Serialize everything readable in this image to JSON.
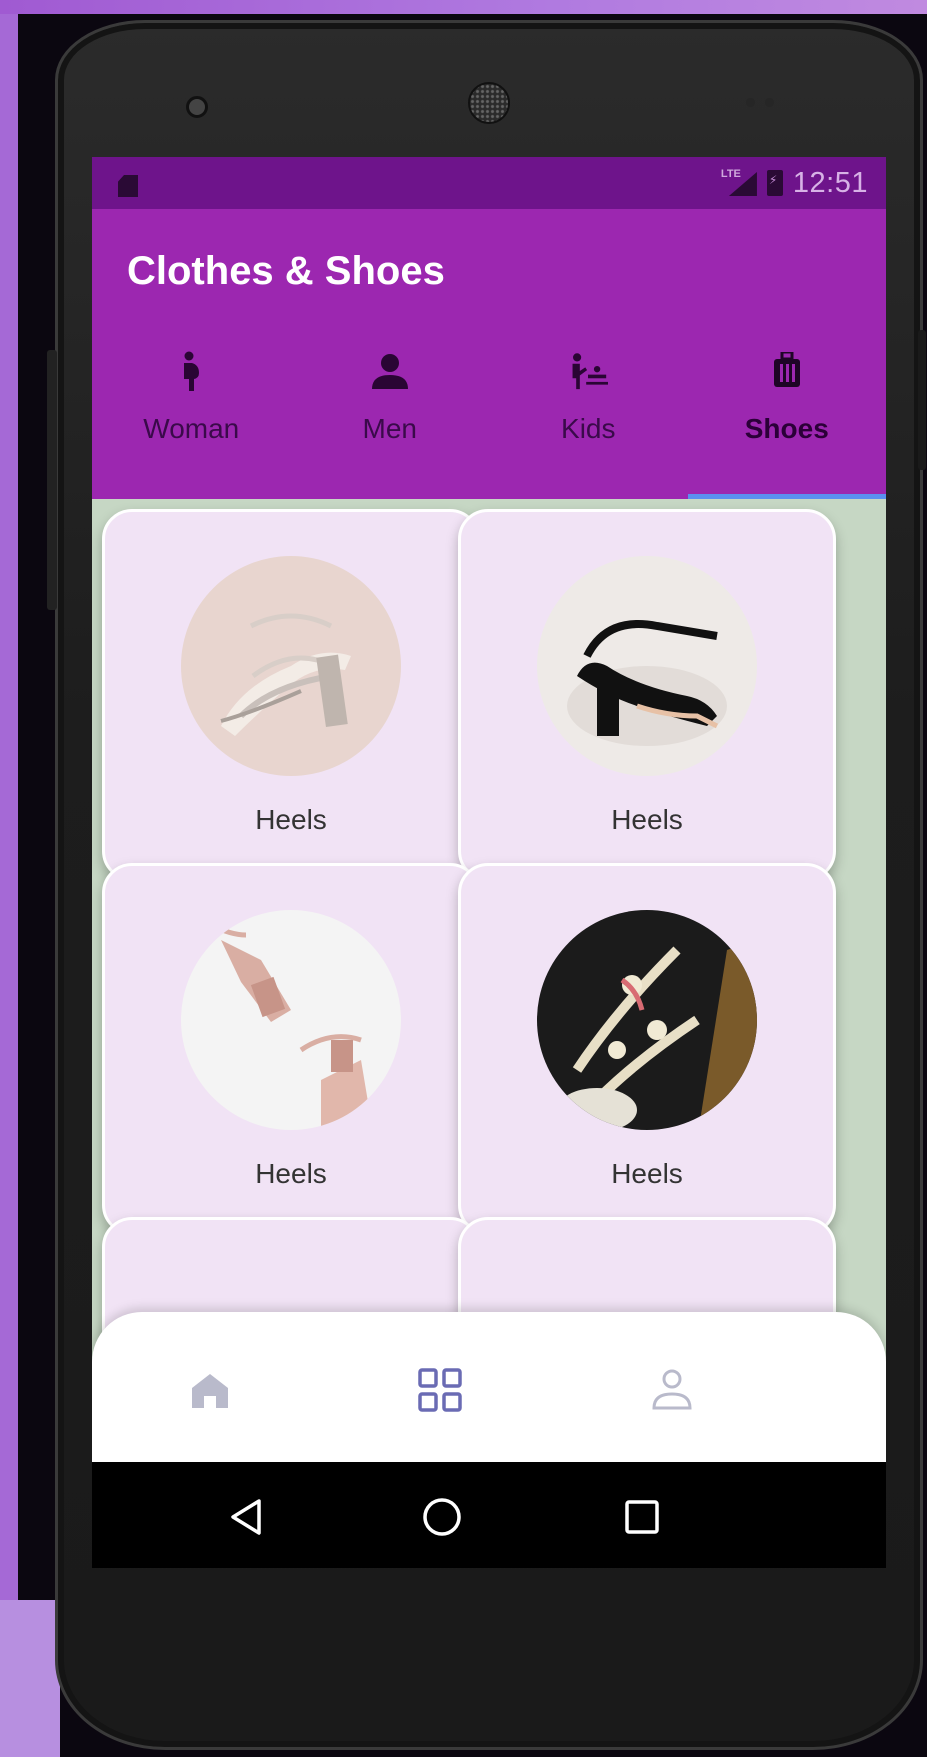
{
  "status_bar": {
    "time": "12:51",
    "network_label": "LTE",
    "icons": [
      "sim-card-icon",
      "signal-icon",
      "battery-charging-icon"
    ]
  },
  "app_bar": {
    "title": "Clothes & Shoes"
  },
  "tabs": [
    {
      "label": "Woman",
      "icon": "pregnant-woman-icon",
      "active": false
    },
    {
      "label": "Men",
      "icon": "person-icon",
      "active": false
    },
    {
      "label": "Kids",
      "icon": "baby-changing-icon",
      "active": false
    },
    {
      "label": "Shoes",
      "icon": "luggage-icon",
      "active": true
    }
  ],
  "products": [
    {
      "label": "Heels",
      "image": "beige-glitter-heel"
    },
    {
      "label": "Heels",
      "image": "black-block-heel"
    },
    {
      "label": "Heels",
      "image": "pink-block-heels"
    },
    {
      "label": "Heels",
      "image": "strappy-cream-sandals"
    }
  ],
  "bottom_nav": [
    {
      "icon": "home-icon",
      "active": false
    },
    {
      "icon": "grid-icon",
      "active": true
    },
    {
      "icon": "profile-icon",
      "active": false
    }
  ],
  "system_nav": [
    "back-icon",
    "home-circle-icon",
    "recents-icon"
  ],
  "colors": {
    "primary": "#9c27b0",
    "status_bar": "#6e148b",
    "card_bg": "#f1e3f5",
    "tab_indicator": "#5a8ff0",
    "nav_icon": "#6a6bb4"
  }
}
